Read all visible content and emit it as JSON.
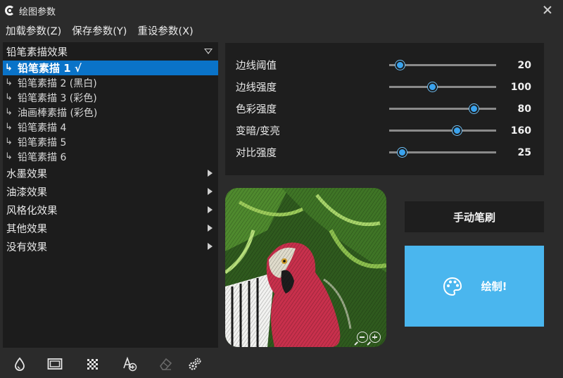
{
  "window": {
    "title": "绘图参数",
    "icons": {
      "app": "app-logo-icon",
      "close": "close-icon"
    }
  },
  "menu": [
    {
      "label": "加载参数(Z)"
    },
    {
      "label": "保存参数(Y)"
    },
    {
      "label": "重设参数(X)"
    }
  ],
  "effects": {
    "expanded_group": "铅笔素描效果",
    "expanded_items": [
      {
        "label": "铅笔素描 1 √",
        "selected": true
      },
      {
        "label": "铅笔素描 2 (黑白)",
        "selected": false
      },
      {
        "label": "铅笔素描 3 (彩色)",
        "selected": false
      },
      {
        "label": "油画棒素描 (彩色)",
        "selected": false
      },
      {
        "label": "铅笔素描 4",
        "selected": false
      },
      {
        "label": "铅笔素描 5",
        "selected": false
      },
      {
        "label": "铅笔素描 6",
        "selected": false
      }
    ],
    "collapsed_groups": [
      {
        "label": "水墨效果"
      },
      {
        "label": "油漆效果"
      },
      {
        "label": "风格化效果"
      },
      {
        "label": "其他效果"
      },
      {
        "label": "没有效果"
      }
    ]
  },
  "params": [
    {
      "label": "边线阈值",
      "value": "20",
      "slider_fraction": 0.1
    },
    {
      "label": "边线强度",
      "value": "100",
      "slider_fraction": 0.4
    },
    {
      "label": "色彩强度",
      "value": "80",
      "slider_fraction": 0.79
    },
    {
      "label": "变暗/变亮",
      "value": "160",
      "slider_fraction": 0.63
    },
    {
      "label": "对比强度",
      "value": "25",
      "slider_fraction": 0.12
    }
  ],
  "preview": {
    "zoom_out_icon": "zoom-out-icon",
    "zoom_in_icon": "zoom-in-icon"
  },
  "buttons": {
    "manual_brush": "手动笔刷",
    "draw": "绘制!",
    "draw_icon": "palette-icon"
  },
  "toolbar": [
    {
      "icon": "droplet-icon"
    },
    {
      "icon": "frame-icon"
    },
    {
      "icon": "checkerboard-icon"
    },
    {
      "icon": "add-text-icon"
    },
    {
      "icon": "eraser-icon",
      "disabled": true
    },
    {
      "icon": "settings-icon"
    }
  ],
  "colors": {
    "background": "#2b2b2b",
    "panel": "#1e1e1e",
    "selection": "#0a73c8",
    "accent": "#4ab6ee",
    "slider_thumb": "#3aa3ee"
  }
}
